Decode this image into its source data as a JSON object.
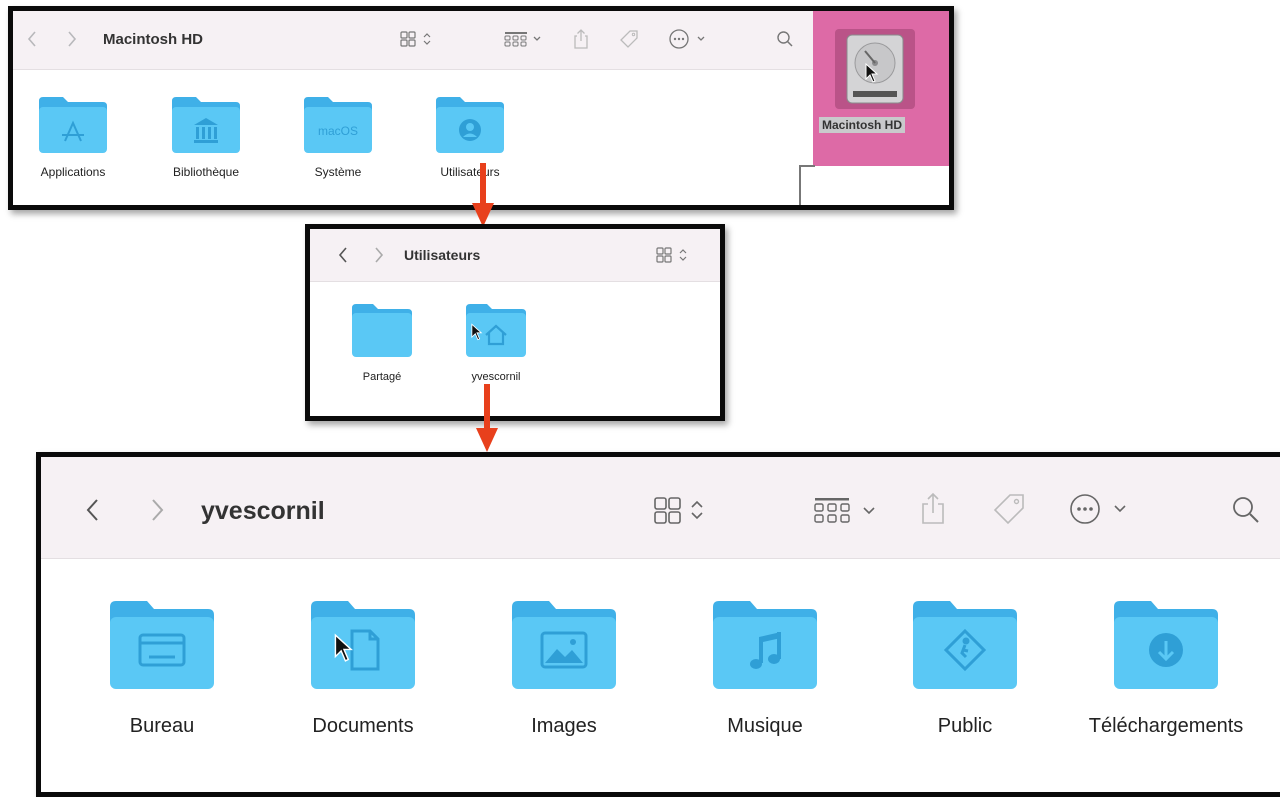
{
  "win1": {
    "title": "Macintosh HD",
    "folders": [
      {
        "label": "Applications",
        "icon": "applications-glyph-icon"
      },
      {
        "label": "Bibliothèque",
        "icon": "library-glyph-icon"
      },
      {
        "label": "Système",
        "icon": "macos-glyph-icon",
        "glyph_text": "macOS"
      },
      {
        "label": "Utilisateurs",
        "icon": "user-glyph-icon"
      }
    ]
  },
  "desktop": {
    "disk_label": "Macintosh HD",
    "background_color": "#dd6aa6"
  },
  "win2": {
    "title": "Utilisateurs",
    "folders": [
      {
        "label": "Partagé",
        "icon": "plain-folder"
      },
      {
        "label": "yvescornil",
        "icon": "home-glyph-icon"
      }
    ]
  },
  "win3": {
    "title": "yvescornil",
    "folders": [
      {
        "label": "Bureau",
        "icon": "desktop-glyph-icon"
      },
      {
        "label": "Documents",
        "icon": "document-glyph-icon"
      },
      {
        "label": "Images",
        "icon": "picture-glyph-icon"
      },
      {
        "label": "Musique",
        "icon": "music-glyph-icon"
      },
      {
        "label": "Public",
        "icon": "public-glyph-icon"
      },
      {
        "label": "Téléchargements",
        "icon": "download-glyph-icon"
      }
    ]
  },
  "colors": {
    "folder_body": "#5ac8f5",
    "folder_tab": "#3fb0e8",
    "arrow": "#e8401c",
    "window_border": "#0a0a0a",
    "toolbar_bg": "#f6f1f4"
  }
}
